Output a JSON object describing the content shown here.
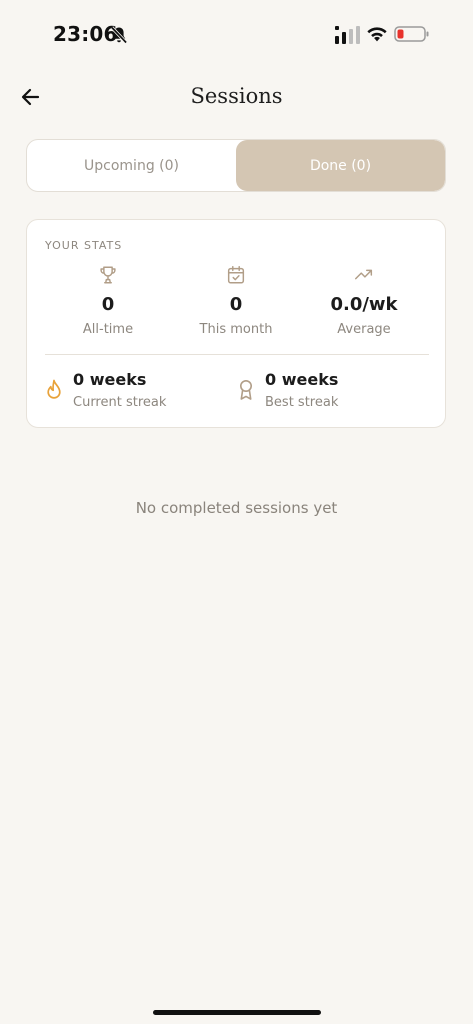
{
  "status_bar": {
    "time": "23:06",
    "icons": [
      "bell-muted-icon",
      "cellular-signal-icon",
      "wifi-icon",
      "battery-low-icon"
    ]
  },
  "header": {
    "title": "Sessions",
    "back_icon": "arrow-left-icon"
  },
  "tabs": [
    {
      "label": "Upcoming (0)",
      "selected": false
    },
    {
      "label": "Done (0)",
      "selected": true
    }
  ],
  "stats": {
    "heading": "YOUR STATS",
    "items": [
      {
        "icon": "trophy-icon",
        "value": "0",
        "label": "All-time"
      },
      {
        "icon": "calendar-check-icon",
        "value": "0",
        "label": "This month"
      },
      {
        "icon": "trending-up-icon",
        "value": "0.0/wk",
        "label": "Average"
      }
    ],
    "streaks": [
      {
        "icon": "flame-icon",
        "value": "0 weeks",
        "label": "Current streak"
      },
      {
        "icon": "award-ribbon-icon",
        "value": "0 weeks",
        "label": "Best streak"
      }
    ]
  },
  "empty_state": "No completed sessions yet",
  "colors": {
    "background": "#f8f6f2",
    "accent": "#d4c6b3",
    "icon_muted": "#b19e88",
    "flame": "#e8a23a",
    "text_muted": "#8d877f"
  }
}
